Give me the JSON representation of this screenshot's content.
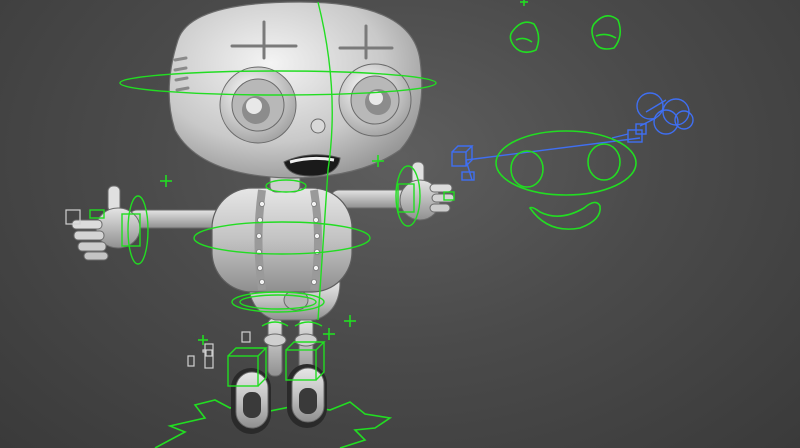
{
  "viewport": {
    "background_top": "#5e5e5e",
    "background_bottom": "#3a3a3a",
    "label": ""
  },
  "scene": {
    "model": "cartoon-robot",
    "shading": "matte-gray",
    "rig_control_color": "#22dd22",
    "ik_chain_color": "#3f6ff2",
    "bone_color": "#d0d0d0"
  },
  "icons": {
    "face_controls": "face-rig-controls-icon",
    "ik_chain": "ik-chain-icon",
    "transform_cross": "transform-cross-icon"
  }
}
